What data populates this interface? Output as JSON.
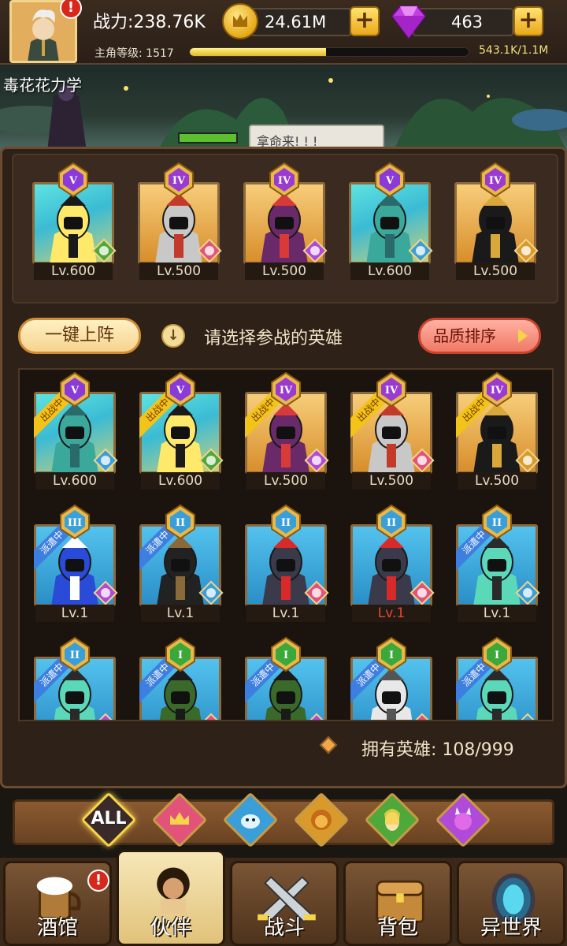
{
  "header": {
    "power": "战力:238.76K",
    "coins": "24.61M",
    "gems": "463",
    "level_label": "主角等级: 1517",
    "exp_text": "543.1K/1.1M",
    "exp_progress": 0.49,
    "alert": "!"
  },
  "scene": {
    "player_name": "毒花花力学",
    "speech": "拿命来! ! !"
  },
  "lineup": [
    {
      "rank": "V",
      "level": "Lv.600",
      "bg": "teal",
      "figure": "yellow-mage",
      "elem": "elf"
    },
    {
      "rank": "IV",
      "level": "Lv.500",
      "bg": "gold",
      "figure": "knight",
      "elem": "crown"
    },
    {
      "rank": "IV",
      "level": "Lv.500",
      "bg": "gold",
      "figure": "demon-lord",
      "elem": "demon"
    },
    {
      "rank": "V",
      "level": "Lv.600",
      "bg": "teal",
      "figure": "sea-beast",
      "elem": "fish"
    },
    {
      "rank": "IV",
      "level": "Lv.500",
      "bg": "gold",
      "figure": "pharaoh",
      "elem": "lion"
    }
  ],
  "controls": {
    "quick_deploy": "一键上阵",
    "tip": "请选择参战的英雄",
    "sort": "品质排序"
  },
  "roster": [
    {
      "rank": "V",
      "level": "Lv.600",
      "bg": "teal",
      "figure": "sea-beast",
      "elem": "fish",
      "tag": "出战中",
      "tag_type": "out"
    },
    {
      "rank": "V",
      "level": "Lv.600",
      "bg": "teal",
      "figure": "yellow-mage",
      "elem": "elf",
      "tag": "出战中",
      "tag_type": "out"
    },
    {
      "rank": "IV",
      "level": "Lv.500",
      "bg": "gold",
      "figure": "demon-lord",
      "elem": "demon",
      "tag": "出战中",
      "tag_type": "out"
    },
    {
      "rank": "IV",
      "level": "Lv.500",
      "bg": "gold",
      "figure": "knight",
      "elem": "crown",
      "tag": "出战中",
      "tag_type": "out"
    },
    {
      "rank": "IV",
      "level": "Lv.500",
      "bg": "gold",
      "figure": "pharaoh",
      "elem": "lion",
      "tag": "出战中",
      "tag_type": "out"
    },
    {
      "rank": "III",
      "level": "Lv.1",
      "bg": "blue",
      "figure": "blue-girl",
      "elem": "demon",
      "tag": "派遣中",
      "tag_type": "dispatch"
    },
    {
      "rank": "II",
      "level": "Lv.1",
      "bg": "blue",
      "figure": "dark-tree",
      "elem": "fish",
      "tag": "派遣中",
      "tag_type": "dispatch"
    },
    {
      "rank": "II",
      "level": "Lv.1",
      "bg": "blue",
      "figure": "red-hood",
      "elem": "crown",
      "tag": "",
      "tag_type": ""
    },
    {
      "rank": "II",
      "level": "Lv.1",
      "bg": "blue",
      "figure": "red-hood",
      "elem": "crown",
      "tag": "",
      "tag_type": "",
      "level_red": true
    },
    {
      "rank": "II",
      "level": "Lv.1",
      "bg": "blue",
      "figure": "medusa",
      "elem": "fish",
      "tag": "派遣中",
      "tag_type": "dispatch"
    },
    {
      "rank": "II",
      "level": "",
      "bg": "blue",
      "figure": "medusa",
      "elem": "demon",
      "tag": "派遣中",
      "tag_type": "dispatch"
    },
    {
      "rank": "I",
      "level": "",
      "bg": "blue",
      "figure": "green-hood",
      "elem": "crown",
      "tag": "派遣中",
      "tag_type": "dispatch"
    },
    {
      "rank": "I",
      "level": "",
      "bg": "blue",
      "figure": "green-hood",
      "elem": "demon",
      "tag": "派遣中",
      "tag_type": "dispatch"
    },
    {
      "rank": "I",
      "level": "",
      "bg": "blue",
      "figure": "white-monk",
      "elem": "crown",
      "tag": "派遣中",
      "tag_type": "dispatch"
    },
    {
      "rank": "I",
      "level": "",
      "bg": "blue",
      "figure": "medusa",
      "elem": "fish",
      "tag": "派遣中",
      "tag_type": "dispatch"
    }
  ],
  "owned": {
    "label": "拥有英雄: 108/999"
  },
  "filters": [
    {
      "id": "all",
      "label": "ALL",
      "color": "#3b2a2a"
    },
    {
      "id": "crown",
      "label": "",
      "color": "#e2537a"
    },
    {
      "id": "fish",
      "label": "",
      "color": "#3a9fd8"
    },
    {
      "id": "lion",
      "label": "",
      "color": "#d89a2a"
    },
    {
      "id": "elf",
      "label": "",
      "color": "#4fa83a"
    },
    {
      "id": "demon",
      "label": "",
      "color": "#b04ad8"
    }
  ],
  "nav": [
    {
      "label": "酒馆",
      "icon": "beer-icon",
      "alert": "!"
    },
    {
      "label": "伙伴",
      "icon": "partner-icon",
      "active": true
    },
    {
      "label": "战斗",
      "icon": "swords-icon"
    },
    {
      "label": "背包",
      "icon": "chest-icon"
    },
    {
      "label": "异世界",
      "icon": "portal-icon"
    }
  ]
}
